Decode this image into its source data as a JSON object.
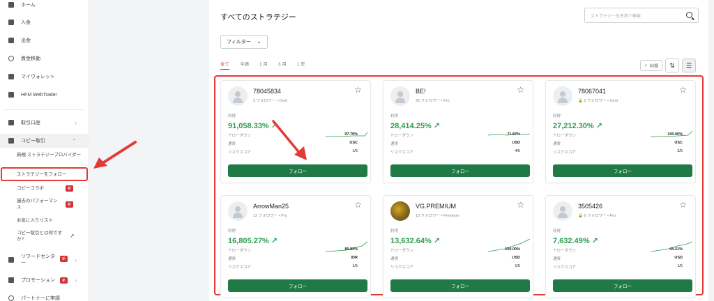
{
  "sidebar": {
    "items": [
      {
        "label": "ホーム"
      },
      {
        "label": "入金"
      },
      {
        "label": "出金"
      },
      {
        "label": "資金移動"
      },
      {
        "label": "マイウォレット"
      },
      {
        "label": "HFM WebTrader"
      }
    ],
    "trading_accounts": "取引口座",
    "copy_trading": "コピー取引",
    "sub_items": {
      "new_provider": "新規 ストラテジープロバイダー",
      "follow_strategy": "ストラテジーをフォロー",
      "copy_collab": "コピーコラボ",
      "past_performance": "過去のパフォーマンス",
      "favorites": "お気に入りリスト",
      "what_is_copy": "コピー取引とは何ですか?"
    },
    "reward_center": "リワードセンター",
    "promotions": "プロモーション",
    "partner": "パートナーに申請",
    "new_badge": "新"
  },
  "main": {
    "title": "すべてのストラテジー",
    "search_placeholder": "ストラテジーを名称で検索",
    "filter_label": "フィルター",
    "tabs": [
      "全て",
      "今週",
      "1 月",
      "3 月",
      "1 年"
    ],
    "sort_label": "利得"
  },
  "card_labels": {
    "profit": "利得",
    "drawdown": "ドローダウン",
    "currency": "通貨",
    "risk": "リスクスコア",
    "follow": "フォロー"
  },
  "cards": [
    {
      "name": "78045834",
      "meta": "3 フォロワー • Cent",
      "profit": "91,058.33%",
      "drawdown": "97.79%",
      "currency": "USC",
      "risk": "1/5"
    },
    {
      "name": "BE!",
      "meta": "35 フォロワー • Pro",
      "profit": "28,414.25%",
      "drawdown": "71.87%",
      "currency": "USD",
      "risk": "4/5"
    },
    {
      "name": "78067041",
      "meta": "2 フォロワー • Cent",
      "profit": "27,212.30%",
      "drawdown": "100.00%",
      "currency": "USC",
      "risk": "2/5"
    },
    {
      "name": "ArrowMan25",
      "meta": "12 フォロワー • Pro",
      "profit": "16,805.27%",
      "drawdown": "89.83%",
      "currency": "IDR",
      "risk": "1/5"
    },
    {
      "name": "VG.PREMIUM",
      "meta": "13 フォロワー • Premium",
      "profit": "13,632.64%",
      "drawdown": "100.00%",
      "currency": "USD",
      "risk": "1/5"
    },
    {
      "name": "3505426",
      "meta": "6 フォロワー • Pro",
      "profit": "7,632.49%",
      "drawdown": "44.21%",
      "currency": "USD",
      "risk": "1/5"
    }
  ],
  "colors": {
    "accent": "#d32f2f",
    "profit": "#2e9b4f",
    "button": "#1f7a45"
  }
}
